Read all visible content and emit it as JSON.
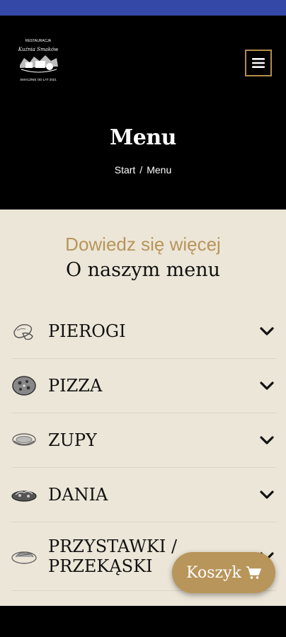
{
  "header": {
    "logo": {
      "lines": [
        "RESTAURACJA",
        "Kuźnia Smaków",
        "SMACZNIE OD LAT 2021"
      ]
    },
    "menu_button_icon": "hamburger-icon",
    "title": "Menu",
    "breadcrumb": [
      "Start",
      "/",
      "Menu"
    ]
  },
  "section": {
    "subtitle": "Dowiedz się więcej",
    "heading": "O naszym menu"
  },
  "menu": [
    {
      "label": "PIEROGI",
      "icon": "pierogi-icon"
    },
    {
      "label": "PIZZA",
      "icon": "pizza-icon"
    },
    {
      "label": "ZUPY",
      "icon": "soup-icon"
    },
    {
      "label": "DANIA",
      "icon": "dish-icon"
    },
    {
      "label": "PRZYSTAWKI / PRZEKĄSKI",
      "icon": "appetizer-icon"
    }
  ],
  "basket": {
    "label": "Koszyk",
    "icon": "cart-icon"
  },
  "colors": {
    "statusbar": "#3448a8",
    "accent": "#b8955a",
    "background": "#ece6d8",
    "header": "#000000"
  }
}
